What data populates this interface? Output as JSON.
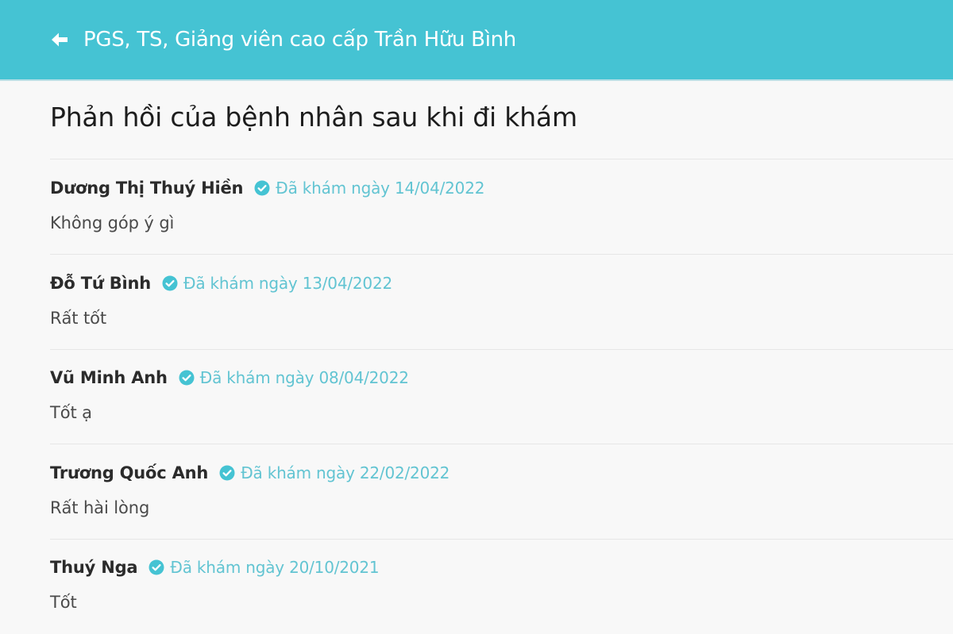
{
  "header": {
    "title": "PGS, TS, Giảng viên cao cấp Trần Hữu Bình",
    "back_icon": "arrow-left-icon",
    "background_color": "#45c3d3"
  },
  "page": {
    "title": "Phản hồi của bệnh nhân sau khi đi khám"
  },
  "verified_icon": "check-circle-icon",
  "accent_color": "#62c4d2",
  "reviews": [
    {
      "name": "Dương Thị Thuý Hiền",
      "date_text": "Đã khám ngày 14/04/2022",
      "comment": "Không góp ý gì"
    },
    {
      "name": "Đỗ Tứ Bình",
      "date_text": "Đã khám ngày 13/04/2022",
      "comment": "Rất tốt"
    },
    {
      "name": "Vũ Minh Anh",
      "date_text": "Đã khám ngày 08/04/2022",
      "comment": "Tốt ạ"
    },
    {
      "name": "Trương Quốc Anh",
      "date_text": "Đã khám ngày 22/02/2022",
      "comment": "Rất hài lòng"
    },
    {
      "name": "Thuý Nga",
      "date_text": "Đã khám ngày 20/10/2021",
      "comment": "Tốt"
    }
  ]
}
